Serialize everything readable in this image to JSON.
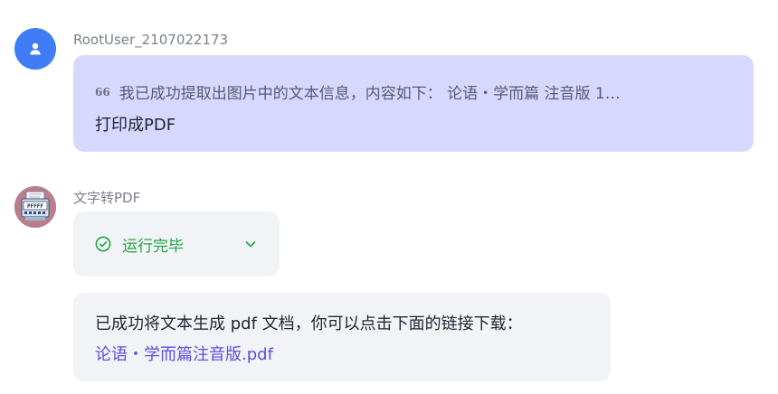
{
  "user": {
    "name": "RootUser_2107022173",
    "avatar_icon": "user-icon",
    "avatar_color": "#3f7cf5",
    "quote": "我已成功提取出图片中的文本信息，内容如下： 论语・学而篇 注音版 1…",
    "message": "打印成PDF"
  },
  "bot": {
    "name": "文字转PDF",
    "avatar_icon": "pdf-typewriter-icon",
    "avatar_label": "PFFFF",
    "status": {
      "label": "运行完毕",
      "icon": "check-circle-icon",
      "color": "#1fa543",
      "toggle_icon": "chevron-down-icon"
    },
    "reply": {
      "text": "已成功将文本生成 pdf 文档，你可以点击下面的链接下载：",
      "link_text": "论语・学而篇注音版.pdf",
      "link_color": "#5b4ee0"
    }
  }
}
